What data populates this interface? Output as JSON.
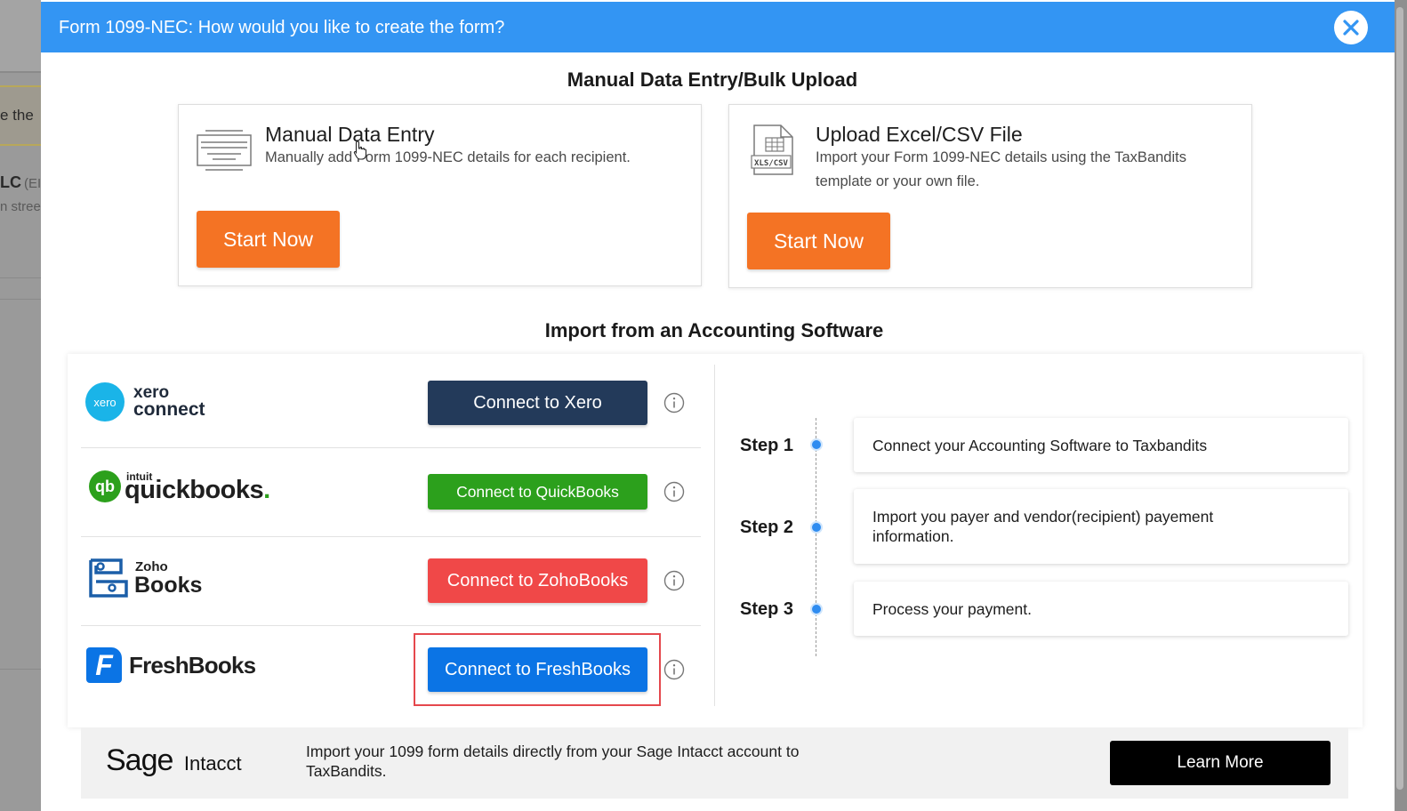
{
  "background": {
    "text_1": "e the",
    "text_2": "LC",
    "text_2b": "(EI",
    "text_3": "n stree"
  },
  "modal": {
    "title": "Form 1099-NEC: How would you like to create the form?",
    "close_icon": "close-icon"
  },
  "manual_section": {
    "title": "Manual Data Entry/Bulk Upload",
    "cards": [
      {
        "icon": "form-lines-icon",
        "title": "Manual Data Entry",
        "description": "Manually add Form 1099-NEC details for each recipient.",
        "button": "Start Now"
      },
      {
        "icon": "xls-csv-file-icon",
        "icon_label": "XLS/CSV",
        "title": "Upload Excel/CSV File",
        "description": "Import your Form 1099-NEC details using the TaxBandits template or your own file.",
        "button": "Start Now"
      }
    ]
  },
  "accounting_section": {
    "title": "Import from an Accounting Software",
    "integrations": [
      {
        "logo_small": "xero",
        "logo_text": "xero",
        "logo_text_2": "connect",
        "button": "Connect to Xero",
        "color": "#233a5a"
      },
      {
        "logo_small": "intuit",
        "logo_text": "quickbooks",
        "logo_dot": ".",
        "button": "Connect to QuickBooks",
        "color": "#2ca01c"
      },
      {
        "logo_small": "Zoho",
        "logo_text": "Books",
        "button": "Connect to ZohoBooks",
        "color": "#f04848"
      },
      {
        "logo_text": "FreshBooks",
        "button": "Connect to FreshBooks",
        "color": "#0b74e5"
      }
    ],
    "steps": [
      {
        "label": "Step 1",
        "text": "Connect your Accounting Software to Taxbandits"
      },
      {
        "label": "Step 2",
        "text": "Import you payer and vendor(recipient) payement information."
      },
      {
        "label": "Step 3",
        "text": "Process your payment."
      }
    ],
    "sage": {
      "logo_text": "Sage",
      "logo_text_2": "Intacct",
      "description": "Import your 1099 form details directly from your Sage Intacct account to TaxBandits.",
      "button": "Learn More"
    }
  },
  "colors": {
    "header": "#3395f3",
    "accent_orange": "#f47324",
    "highlight": "#e5484d"
  }
}
